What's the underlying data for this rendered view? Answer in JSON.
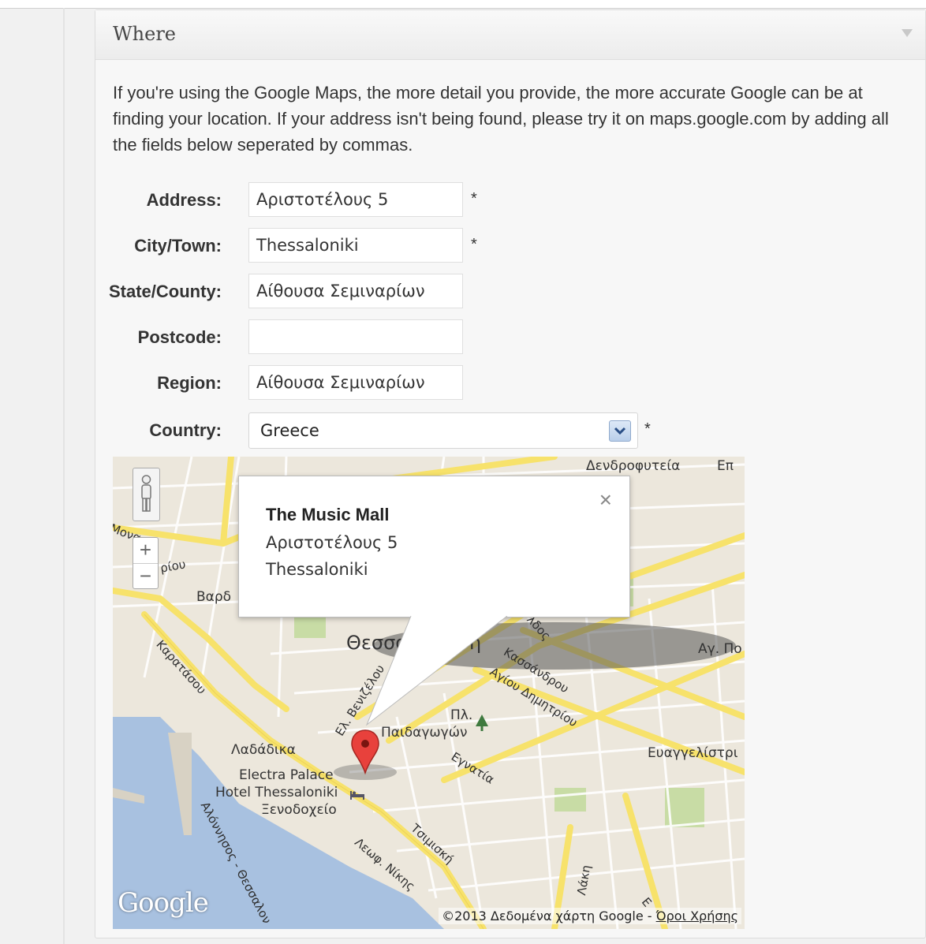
{
  "metabox": {
    "title": "Where"
  },
  "intro": "If you're using the Google Maps, the more detail you provide, the more accurate Google can be at finding your location. If your address isn't being found, please try it on maps.google.com by adding all the fields below seperated by commas.",
  "fields": {
    "address": {
      "label": "Address:",
      "value": "Αριστοτέλους 5",
      "required": "*"
    },
    "city": {
      "label": "City/Town:",
      "value": "Thessaloniki",
      "required": "*"
    },
    "state": {
      "label": "State/County:",
      "value": "Αίθουσα Σεμιναρίων"
    },
    "postcode": {
      "label": "Postcode:",
      "value": ""
    },
    "region": {
      "label": "Region:",
      "value": "Αίθουσα Σεμιναρίων"
    },
    "country": {
      "label": "Country:",
      "value": "Greece",
      "required": "*"
    }
  },
  "map": {
    "zoom_in": "+",
    "zoom_out": "−",
    "info": {
      "title": "The Music Mall",
      "line1": "Αριστοτέλους 5",
      "line2": "Thessaloniki",
      "close": "×"
    },
    "labels": {
      "area_top": "Δενδροφυτεία",
      "area_top2": "Επ",
      "city": "Θεσσαλ",
      "city_end": "η",
      "vardaris": "Βαρδ",
      "ag_p": "Αγ. Πο",
      "square1": "Πλ.",
      "square2": "Παιδαγωγών",
      "ladadika": "Λαδάδικα",
      "hotel1": "Electra Palace",
      "hotel2": "Hotel Thessaloniki",
      "hotel3": "Ξενοδοχείο",
      "evangelistria": "Ευαγγελίστρι",
      "road_karatasou": "Καρατάσου",
      "road_venizelou": "Ελ. Βενιζέλου",
      "road_kassandrou": "Κασσάνδρου",
      "road_dimitriou": "Αγίου Δημητρίου",
      "road_egnatia": "Εγνατία",
      "road_tsimiski": "Τσιμισκή",
      "road_nikis": "Λεωφ. Νίκης",
      "road_alonnisos": "Αλόννησος - Θεσσαλον",
      "road_frag": "Μονα",
      "road_frag2": "ρίου",
      "road_top": "λδος",
      "road_laki": "Λάκη",
      "road_e": "Ε"
    },
    "logo": "Google",
    "attribution": "©2013 Δεδομένα χάρτη Google - ",
    "terms": "Όροι Χρήσης",
    "colors": {
      "sea": "#a8c1e0",
      "land": "#ece7dc",
      "major_road": "#f7e26b",
      "park": "#c8dca5"
    }
  }
}
